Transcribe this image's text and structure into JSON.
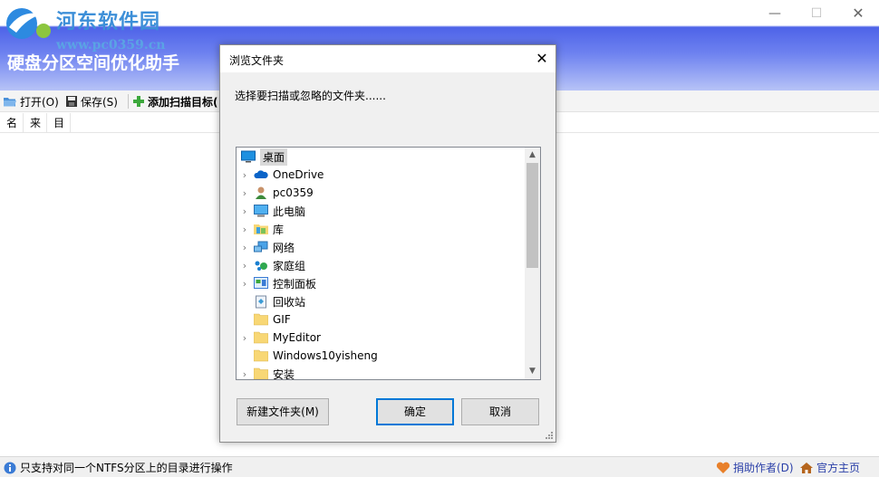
{
  "watermark": {
    "title": "河东软件园",
    "url": "www.pc0359.cn"
  },
  "app": {
    "title": "硬盘分区空间优化助手"
  },
  "window_controls": {
    "minimize": "—",
    "maximize": "☐",
    "close": "✕"
  },
  "toolbar": {
    "open": "打开(O)",
    "save": "保存(S)",
    "add": "添加扫描目标("
  },
  "columns": [
    "名",
    "来",
    "目"
  ],
  "dialog": {
    "title": "浏览文件夹",
    "close": "✕",
    "description": "选择要扫描或忽略的文件夹......",
    "tree": [
      {
        "label": "桌面",
        "icon": "desktop-icon",
        "expandable": false
      },
      {
        "label": "OneDrive",
        "icon": "onedrive-icon",
        "expandable": true
      },
      {
        "label": "pc0359",
        "icon": "user-icon",
        "expandable": true
      },
      {
        "label": "此电脑",
        "icon": "computer-icon",
        "expandable": true
      },
      {
        "label": "库",
        "icon": "library-icon",
        "expandable": true
      },
      {
        "label": "网络",
        "icon": "network-icon",
        "expandable": true
      },
      {
        "label": "家庭组",
        "icon": "homegroup-icon",
        "expandable": true
      },
      {
        "label": "控制面板",
        "icon": "control-panel-icon",
        "expandable": true
      },
      {
        "label": "回收站",
        "icon": "recycle-bin-icon",
        "expandable": false
      },
      {
        "label": "GIF",
        "icon": "folder-icon",
        "expandable": false
      },
      {
        "label": "MyEditor",
        "icon": "folder-icon",
        "expandable": true
      },
      {
        "label": "Windows10yisheng",
        "icon": "folder-icon",
        "expandable": false
      },
      {
        "label": "安装",
        "icon": "folder-icon",
        "expandable": true
      }
    ],
    "buttons": {
      "new_folder": "新建文件夹(M)",
      "ok": "确定",
      "cancel": "取消"
    }
  },
  "status": {
    "message": "只支持对同一个NTFS分区上的目录进行操作",
    "donate": "捐助作者(D)",
    "homepage": "官方主页"
  },
  "colors": {
    "accent": "#0078d7",
    "header_blue": "#4e63e8",
    "link": "#2a3fa8",
    "folder": "#f8d775"
  }
}
